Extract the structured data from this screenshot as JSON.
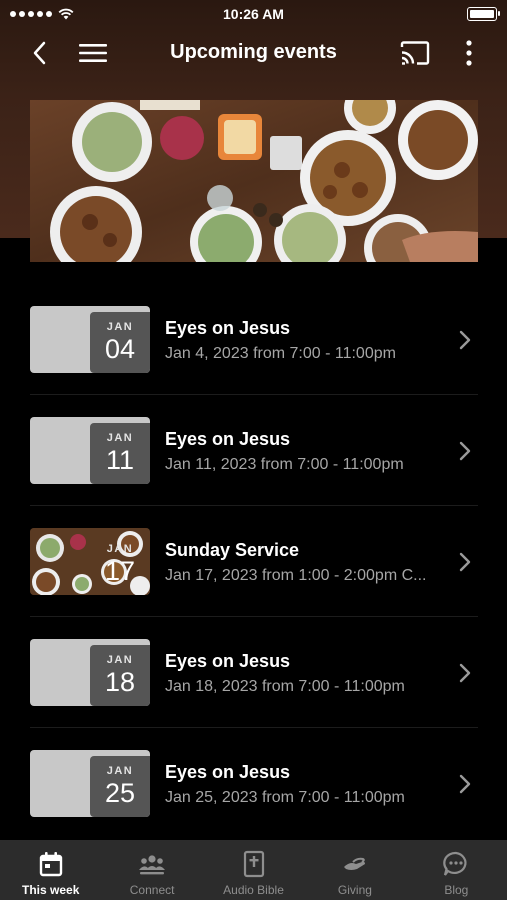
{
  "status_bar": {
    "time": "10:26 AM"
  },
  "nav": {
    "title": "Upcoming events"
  },
  "events": [
    {
      "month": "JAN",
      "day": "04",
      "title": "Eyes on Jesus",
      "subtitle": "Jan 4, 2023 from 7:00 - 11:00pm"
    },
    {
      "month": "JAN",
      "day": "11",
      "title": "Eyes on Jesus",
      "subtitle": "Jan 11, 2023 from 7:00 - 11:00pm"
    },
    {
      "month": "JAN",
      "day": "17",
      "title": "Sunday Service",
      "subtitle": "Jan 17, 2023 from 1:00 - 2:00pm C..."
    },
    {
      "month": "JAN",
      "day": "18",
      "title": "Eyes on Jesus",
      "subtitle": "Jan 18, 2023 from 7:00 - 11:00pm"
    },
    {
      "month": "JAN",
      "day": "25",
      "title": "Eyes on Jesus",
      "subtitle": "Jan 25, 2023 from 7:00 - 11:00pm"
    }
  ],
  "tabs": [
    {
      "label": "This week",
      "icon": "calendar-icon",
      "active": true
    },
    {
      "label": "Connect",
      "icon": "people-icon",
      "active": false
    },
    {
      "label": "Audio Bible",
      "icon": "bible-icon",
      "active": false
    },
    {
      "label": "Giving",
      "icon": "giving-hand-icon",
      "active": false
    },
    {
      "label": "Blog",
      "icon": "chat-bubble-icon",
      "active": false
    }
  ],
  "colors": {
    "tab_active": "#ffffff",
    "tab_inactive": "#8e8e8e",
    "header_brown": "#3b2217"
  }
}
